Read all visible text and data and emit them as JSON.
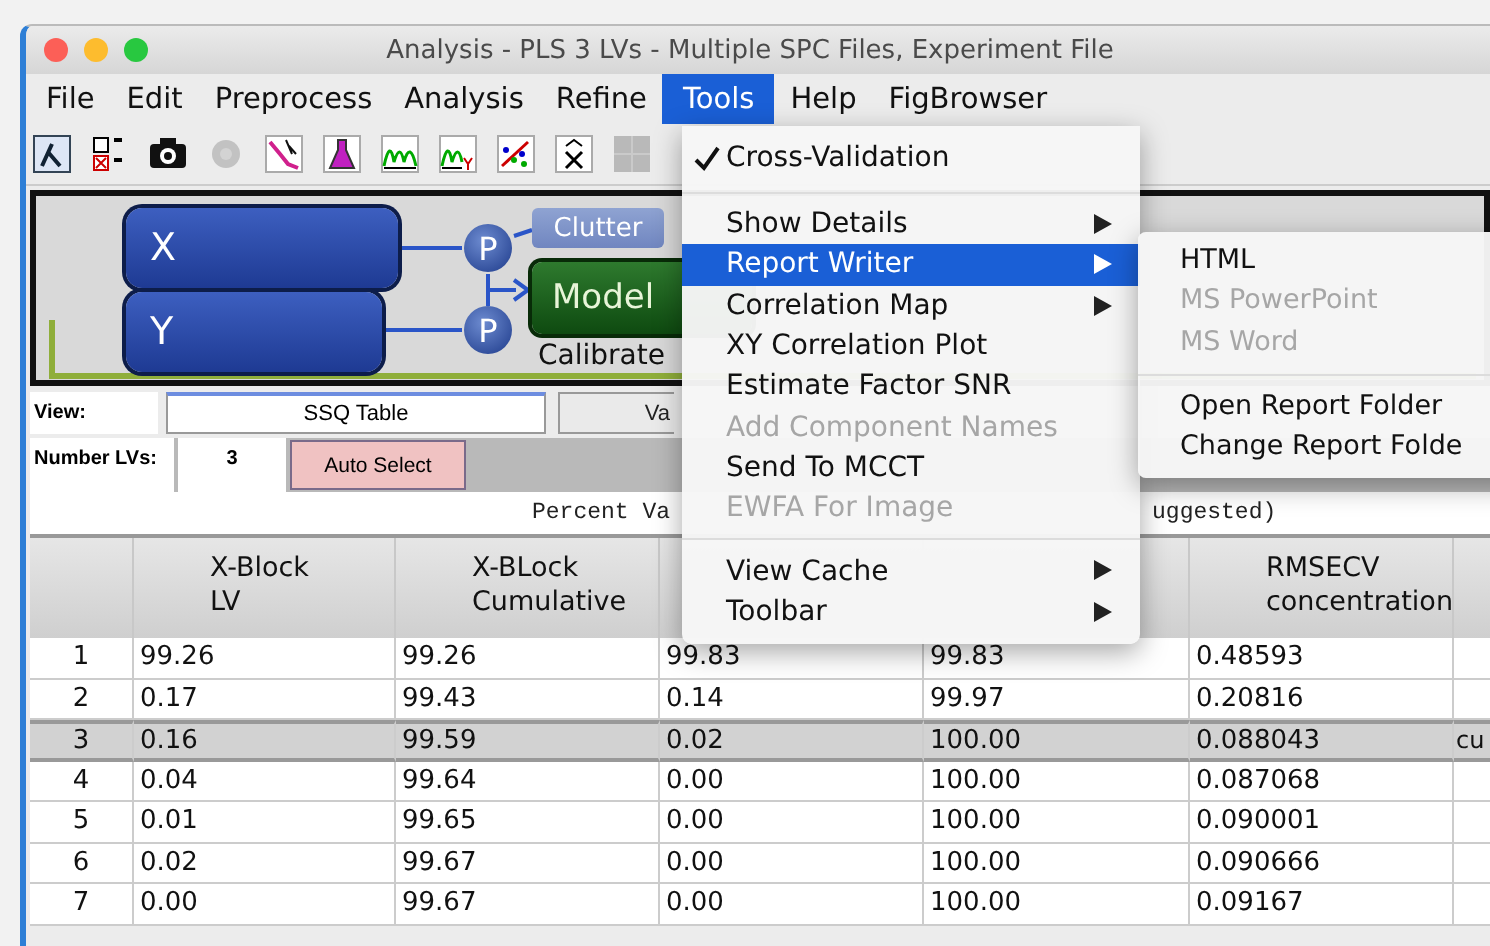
{
  "window": {
    "title": "Analysis - PLS 3 LVs - Multiple SPC Files, Experiment File"
  },
  "menu_bar": [
    {
      "label": "File",
      "selected": false
    },
    {
      "label": "Edit",
      "selected": false
    },
    {
      "label": "Preprocess",
      "selected": false
    },
    {
      "label": "Analysis",
      "selected": false
    },
    {
      "label": "Refine",
      "selected": false
    },
    {
      "label": "Tools",
      "selected": true
    },
    {
      "label": "Help",
      "selected": false
    },
    {
      "label": "FigBrowser",
      "selected": false
    }
  ],
  "toolbar": [
    {
      "kind": "lambda",
      "disabled": false
    },
    {
      "kind": "checklist",
      "disabled": false
    },
    {
      "kind": "camera",
      "disabled": false
    },
    {
      "kind": "gear",
      "disabled": true
    },
    {
      "kind": "lambda-plot",
      "disabled": false
    },
    {
      "kind": "flask",
      "disabled": false
    },
    {
      "kind": "peaks",
      "disabled": false
    },
    {
      "kind": "peaks-y",
      "disabled": false
    },
    {
      "kind": "scatter",
      "disabled": false
    },
    {
      "kind": "xhat",
      "disabled": false
    },
    {
      "kind": "grid",
      "disabled": true
    }
  ],
  "diagram": {
    "x_block": "X",
    "y_block": "Y",
    "preprocess": [
      "P",
      "P"
    ],
    "clutter": {
      "label": "Clutter",
      "disabled": true
    },
    "model": "Model",
    "mode": "Calibrate"
  },
  "view": {
    "label": "View:",
    "options": [
      {
        "label": "SSQ Table",
        "selected": true
      },
      {
        "label": "Va",
        "selected": false
      }
    ]
  },
  "lv": {
    "label": "Number LVs:",
    "value": "3",
    "button": "Auto Select"
  },
  "table": {
    "caption_parts": [
      "Percent Va",
      "uggested)"
    ],
    "columns": [
      {
        "header": "X-Block\nLV"
      },
      {
        "header": "X-BLock\nCumulative"
      },
      {},
      {},
      {
        "header": "RMSECV\nconcentration"
      },
      {}
    ],
    "rows": [
      {
        "index": "1",
        "selected": false,
        "cells": [
          "99.26",
          "99.26",
          "99.83",
          "99.83",
          "0.48593"
        ]
      },
      {
        "index": "2",
        "selected": false,
        "cells": [
          "0.17",
          "99.43",
          "0.14",
          "99.97",
          "0.20816"
        ]
      },
      {
        "index": "3",
        "selected": true,
        "cells": [
          "0.16",
          "99.59",
          "0.02",
          "100.00",
          "0.088043",
          "cu"
        ]
      },
      {
        "index": "4",
        "selected": false,
        "cells": [
          "0.04",
          "99.64",
          "0.00",
          "100.00",
          "0.087068"
        ]
      },
      {
        "index": "5",
        "selected": false,
        "cells": [
          "0.01",
          "99.65",
          "0.00",
          "100.00",
          "0.090001"
        ]
      },
      {
        "index": "6",
        "selected": false,
        "cells": [
          "0.02",
          "99.67",
          "0.00",
          "100.00",
          "0.090666"
        ]
      },
      {
        "index": "7",
        "selected": false,
        "cells": [
          "0.00",
          "99.67",
          "0.00",
          "100.00",
          "0.09167"
        ]
      }
    ]
  },
  "tools_menu": [
    {
      "kind": "check",
      "label": "Cross-Validation",
      "checked": true
    },
    {
      "kind": "separator"
    },
    {
      "kind": "item",
      "label": "Show Details",
      "submenu": true,
      "selected": false,
      "disabled": false
    },
    {
      "kind": "item",
      "label": "Report Writer",
      "submenu": true,
      "selected": true,
      "disabled": false
    },
    {
      "kind": "item",
      "label": "Correlation Map",
      "submenu": true,
      "selected": false,
      "disabled": false
    },
    {
      "kind": "item",
      "label": "XY Correlation Plot",
      "submenu": false,
      "selected": false,
      "disabled": false
    },
    {
      "kind": "item",
      "label": "Estimate Factor SNR",
      "submenu": false,
      "selected": false,
      "disabled": false
    },
    {
      "kind": "item",
      "label": "Add Component Names",
      "submenu": false,
      "selected": false,
      "disabled": true
    },
    {
      "kind": "item",
      "label": "Send To MCCT",
      "submenu": false,
      "selected": false,
      "disabled": false
    },
    {
      "kind": "item",
      "label": "EWFA For Image",
      "submenu": false,
      "selected": false,
      "disabled": true
    },
    {
      "kind": "separator"
    },
    {
      "kind": "item",
      "label": "View Cache",
      "submenu": true,
      "selected": false,
      "disabled": false
    },
    {
      "kind": "item",
      "label": "Toolbar",
      "submenu": true,
      "selected": false,
      "disabled": false
    }
  ],
  "report_writer_menu": [
    {
      "kind": "item",
      "label": "HTML",
      "disabled": false
    },
    {
      "kind": "item",
      "label": "MS PowerPoint",
      "disabled": true
    },
    {
      "kind": "item",
      "label": "MS Word",
      "disabled": true
    },
    {
      "kind": "separator"
    },
    {
      "kind": "item",
      "label": "Open Report Folder",
      "disabled": false
    },
    {
      "kind": "item",
      "label": "Change Report Folde",
      "disabled": false
    }
  ]
}
